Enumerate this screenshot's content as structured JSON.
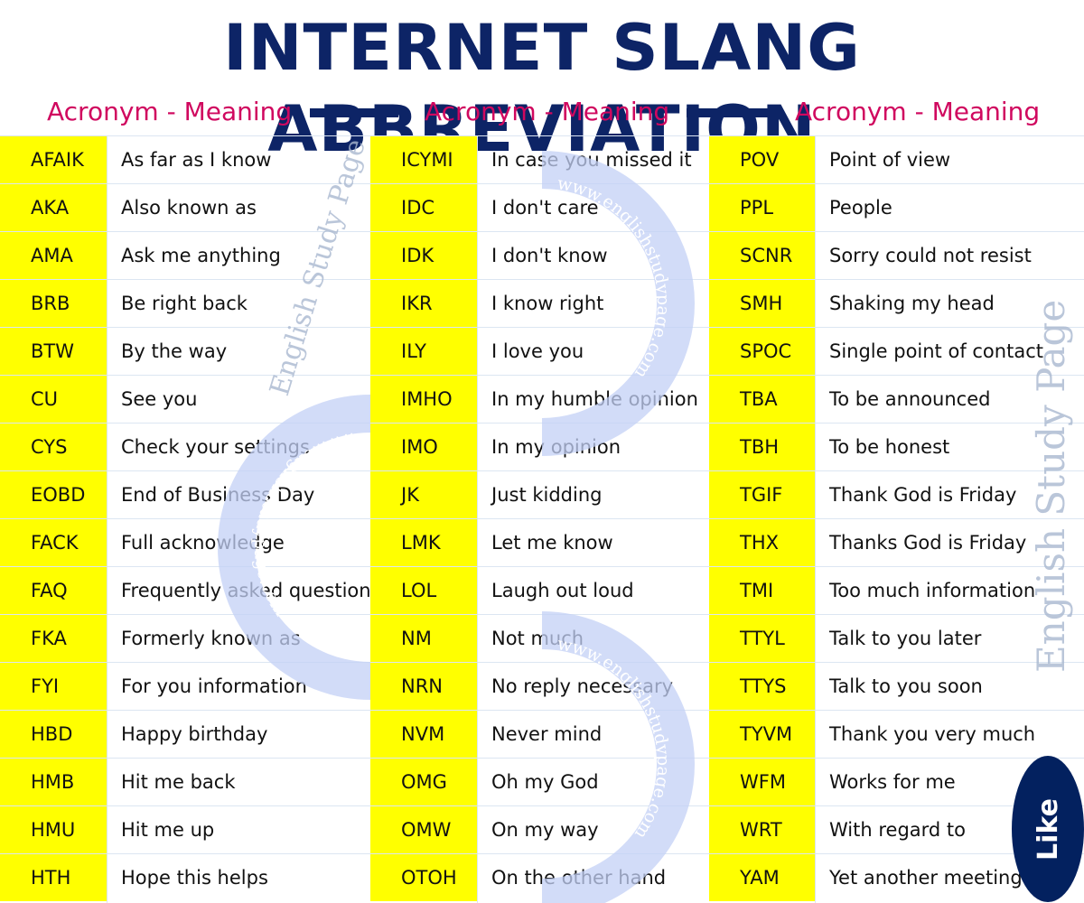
{
  "header": {
    "title": "INTERNET SLANG ABBREVIATION",
    "column_labels": [
      "Acronym - Meaning",
      "Acronym - Meaning",
      "Acronym - Meaning"
    ]
  },
  "colors": {
    "title": "#0d2466",
    "subtitle": "#d0085f",
    "abbr_bg": "#ffff00",
    "watermark": "#c3d0f6",
    "like_bg": "#03215f"
  },
  "columns": [
    {
      "rows": [
        {
          "abbr": "AFAIK",
          "meaning": "As far as I know"
        },
        {
          "abbr": "AKA",
          "meaning": "Also known as"
        },
        {
          "abbr": "AMA",
          "meaning": "Ask me anything"
        },
        {
          "abbr": "BRB",
          "meaning": "Be right back"
        },
        {
          "abbr": "BTW",
          "meaning": "By the way"
        },
        {
          "abbr": "CU",
          "meaning": "See you"
        },
        {
          "abbr": "CYS",
          "meaning": "Check your settings"
        },
        {
          "abbr": "EOBD",
          "meaning": "End of Business Day"
        },
        {
          "abbr": "FACK",
          "meaning": "Full acknowledge"
        },
        {
          "abbr": "FAQ",
          "meaning": "Frequently asked questions"
        },
        {
          "abbr": "FKA",
          "meaning": "Formerly known as"
        },
        {
          "abbr": "FYI",
          "meaning": "For you information"
        },
        {
          "abbr": "HBD",
          "meaning": "Happy birthday"
        },
        {
          "abbr": "HMB",
          "meaning": "Hit me back"
        },
        {
          "abbr": "HMU",
          "meaning": "Hit me up"
        },
        {
          "abbr": "HTH",
          "meaning": "Hope this helps"
        }
      ]
    },
    {
      "rows": [
        {
          "abbr": "ICYMI",
          "meaning": "In case you missed it"
        },
        {
          "abbr": "IDC",
          "meaning": "I don't care"
        },
        {
          "abbr": "IDK",
          "meaning": "I don't know"
        },
        {
          "abbr": "IKR",
          "meaning": "I know right"
        },
        {
          "abbr": "ILY",
          "meaning": "I love you"
        },
        {
          "abbr": "IMHO",
          "meaning": "In my humble opinion"
        },
        {
          "abbr": "IMO",
          "meaning": "In my opinion"
        },
        {
          "abbr": "JK",
          "meaning": "Just kidding"
        },
        {
          "abbr": "LMK",
          "meaning": "Let me know"
        },
        {
          "abbr": "LOL",
          "meaning": "Laugh out loud"
        },
        {
          "abbr": "NM",
          "meaning": "Not much"
        },
        {
          "abbr": "NRN",
          "meaning": "No reply necessary"
        },
        {
          "abbr": "NVM",
          "meaning": "Never mind"
        },
        {
          "abbr": "OMG",
          "meaning": "Oh my God"
        },
        {
          "abbr": "OMW",
          "meaning": "On my way"
        },
        {
          "abbr": "OTOH",
          "meaning": "On the other hand"
        }
      ]
    },
    {
      "rows": [
        {
          "abbr": "POV",
          "meaning": "Point of view"
        },
        {
          "abbr": "PPL",
          "meaning": "People"
        },
        {
          "abbr": "SCNR",
          "meaning": "Sorry could not resist"
        },
        {
          "abbr": "SMH",
          "meaning": "Shaking my head"
        },
        {
          "abbr": "SPOC",
          "meaning": "Single point of contact"
        },
        {
          "abbr": "TBA",
          "meaning": "To be announced"
        },
        {
          "abbr": "TBH",
          "meaning": "To be honest"
        },
        {
          "abbr": "TGIF",
          "meaning": "Thank God is Friday"
        },
        {
          "abbr": "THX",
          "meaning": "Thanks God is Friday"
        },
        {
          "abbr": "TMI",
          "meaning": "Too much information"
        },
        {
          "abbr": "TTYL",
          "meaning": "Talk to you later"
        },
        {
          "abbr": "TTYS",
          "meaning": "Talk to you soon"
        },
        {
          "abbr": "TYVM",
          "meaning": "Thank you very much"
        },
        {
          "abbr": "WFM",
          "meaning": "Works for me"
        },
        {
          "abbr": "WRT",
          "meaning": "With regard to"
        },
        {
          "abbr": "YAM",
          "meaning": "Yet another meeting"
        }
      ]
    }
  ],
  "watermark": {
    "brand": "English Study Page",
    "url": "www.englishstudypage.com"
  },
  "like_button": {
    "label": "Like"
  }
}
